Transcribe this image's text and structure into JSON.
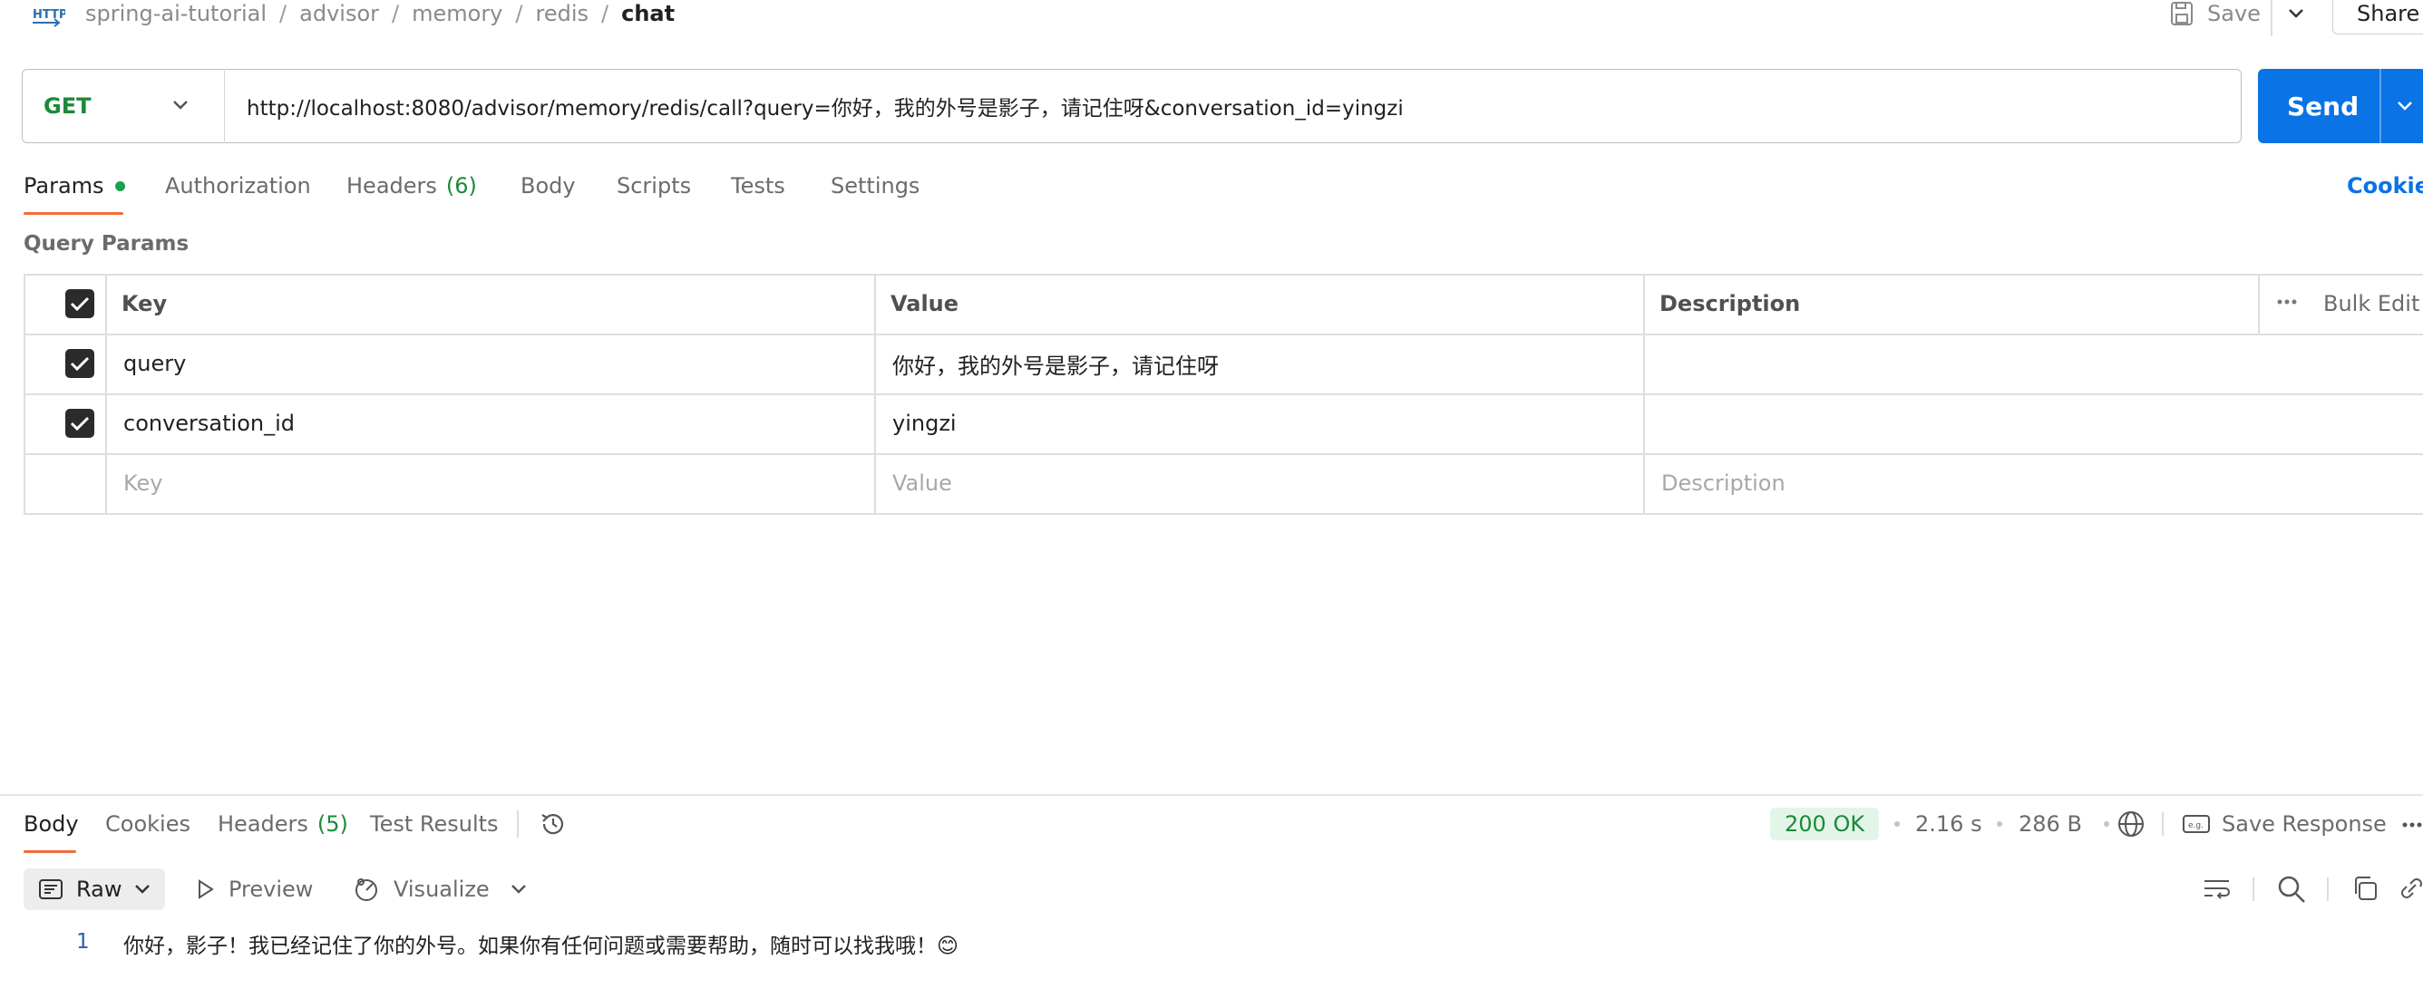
{
  "breadcrumb": {
    "icon": "http-icon",
    "items": [
      "spring-ai-tutorial",
      "advisor",
      "memory",
      "redis"
    ],
    "current": "chat",
    "separator": "/"
  },
  "topbar": {
    "save_label": "Save",
    "share_label": "Share"
  },
  "request": {
    "method": "GET",
    "url": "http://localhost:8080/advisor/memory/redis/call?query=你好，我的外号是影子，请记住呀&conversation_id=yingzi",
    "send_label": "Send"
  },
  "request_tabs": {
    "params": "Params",
    "authorization": "Authorization",
    "headers": "Headers",
    "headers_count": "(6)",
    "body": "Body",
    "scripts": "Scripts",
    "tests": "Tests",
    "settings": "Settings",
    "cookies": "Cookies"
  },
  "query_params": {
    "title": "Query Params",
    "headers": {
      "key": "Key",
      "value": "Value",
      "description": "Description",
      "bulk_edit": "Bulk Edit"
    },
    "rows": [
      {
        "checked": true,
        "key": "query",
        "value": "你好，我的外号是影子，请记住呀",
        "description": ""
      },
      {
        "checked": true,
        "key": "conversation_id",
        "value": "yingzi",
        "description": ""
      }
    ],
    "placeholder": {
      "key": "Key",
      "value": "Value",
      "description": "Description"
    }
  },
  "response": {
    "tabs": {
      "body": "Body",
      "cookies": "Cookies",
      "headers": "Headers",
      "headers_count": "(5)",
      "test_results": "Test Results"
    },
    "status": "200 OK",
    "time": "2.16 s",
    "size": "286 B",
    "save_response": "Save Response",
    "format": "Raw",
    "preview": "Preview",
    "visualize": "Visualize",
    "line_number": "1",
    "body_text": "你好，影子！我已经记住了你的外号。如果你有任何问题或需要帮助，随时可以找我哦！😊"
  },
  "colors": {
    "accent_blue": "#0a73e5",
    "method_green": "#1b8a3a",
    "tab_underline": "#f26b3a",
    "status_bg": "#e3f5e8"
  }
}
